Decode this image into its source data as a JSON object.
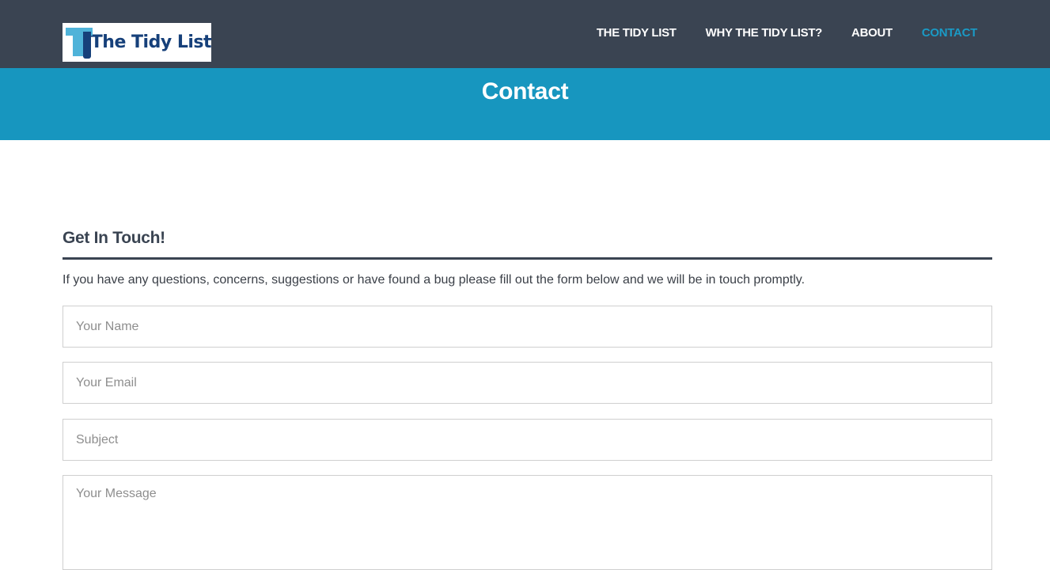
{
  "brand": {
    "logo_text": "The Tidy List"
  },
  "nav": {
    "items": [
      {
        "label": "THE TIDY LIST"
      },
      {
        "label": "WHY THE TIDY LIST?"
      },
      {
        "label": "ABOUT"
      },
      {
        "label": "CONTACT",
        "active": true
      }
    ]
  },
  "banner": {
    "title": "Contact"
  },
  "contact": {
    "heading": "Get In Touch!",
    "intro": "If you have any questions, concerns, suggestions or have found a bug please fill out the form below and we will be in touch promptly.",
    "fields": {
      "name_placeholder": "Your Name",
      "email_placeholder": "Your Email",
      "subject_placeholder": "Subject",
      "message_placeholder": "Your Message"
    }
  },
  "colors": {
    "header_bg": "#3a4452",
    "banner_bg": "#1796bf",
    "active_nav": "#1a9ac5"
  }
}
